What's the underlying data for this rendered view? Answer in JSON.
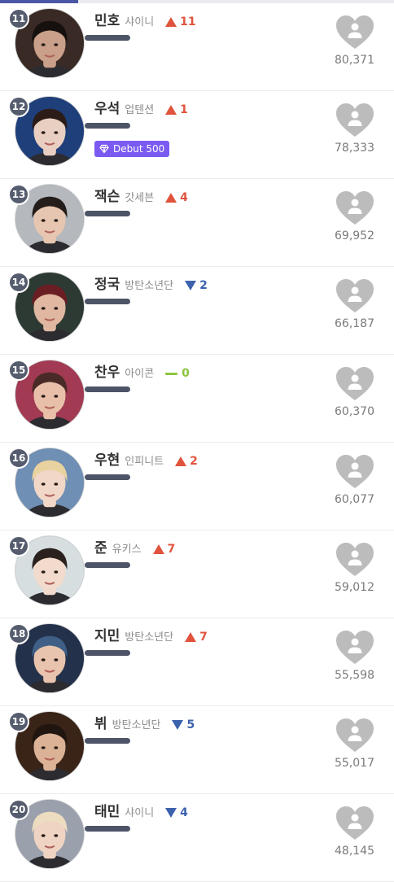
{
  "colors": {
    "up": "#e0533d",
    "down": "#3c62ad",
    "same": "#8cc63f",
    "badge": "#7a5af0",
    "heart": "#bcbcbc",
    "bar": "#4d5467"
  },
  "ranking": [
    {
      "rank": "11",
      "name": "민호",
      "group": "샤이니",
      "dir": "up",
      "change": "11",
      "votes": "80,371",
      "bg": "#3a2a25",
      "skin": "#caa08a",
      "hair": "#16110f"
    },
    {
      "rank": "12",
      "name": "우석",
      "group": "업텐션",
      "dir": "up",
      "change": "1",
      "votes": "78,333",
      "badge": "Debut 500",
      "bg": "#1f3f7a",
      "skin": "#e9cfc2",
      "hair": "#2c1c18"
    },
    {
      "rank": "13",
      "name": "잭슨",
      "group": "갓세븐",
      "dir": "up",
      "change": "4",
      "votes": "69,952",
      "bg": "#b5b8bd",
      "skin": "#e6c6b0",
      "hair": "#241d1a"
    },
    {
      "rank": "14",
      "name": "정국",
      "group": "방탄소년단",
      "dir": "down",
      "change": "2",
      "votes": "66,187",
      "bg": "#2d3a34",
      "skin": "#e0b7a0",
      "hair": "#6a1d22"
    },
    {
      "rank": "15",
      "name": "찬우",
      "group": "아이콘",
      "dir": "same",
      "change": "0",
      "votes": "60,370",
      "bg": "#a13a52",
      "skin": "#e8c0aa",
      "hair": "#4a2a26"
    },
    {
      "rank": "16",
      "name": "우현",
      "group": "인피니트",
      "dir": "up",
      "change": "2",
      "votes": "60,077",
      "bg": "#6f8fb4",
      "skin": "#f1d7c7",
      "hair": "#e8d2a0"
    },
    {
      "rank": "17",
      "name": "준",
      "group": "유키스",
      "dir": "up",
      "change": "7",
      "votes": "59,012",
      "bg": "#d7dee0",
      "skin": "#f2dbcc",
      "hair": "#2a211e"
    },
    {
      "rank": "18",
      "name": "지민",
      "group": "방탄소년단",
      "dir": "up",
      "change": "7",
      "votes": "55,598",
      "bg": "#23314a",
      "skin": "#e8c3ad",
      "hair": "#3f5f86"
    },
    {
      "rank": "19",
      "name": "뷔",
      "group": "방탄소년단",
      "dir": "down",
      "change": "5",
      "votes": "55,017",
      "bg": "#3a2418",
      "skin": "#dbb296",
      "hair": "#21160f"
    },
    {
      "rank": "20",
      "name": "태민",
      "group": "샤이니",
      "dir": "down",
      "change": "4",
      "votes": "48,145",
      "bg": "#9aa0ac",
      "skin": "#efd3c3",
      "hair": "#ecdcc0"
    }
  ]
}
